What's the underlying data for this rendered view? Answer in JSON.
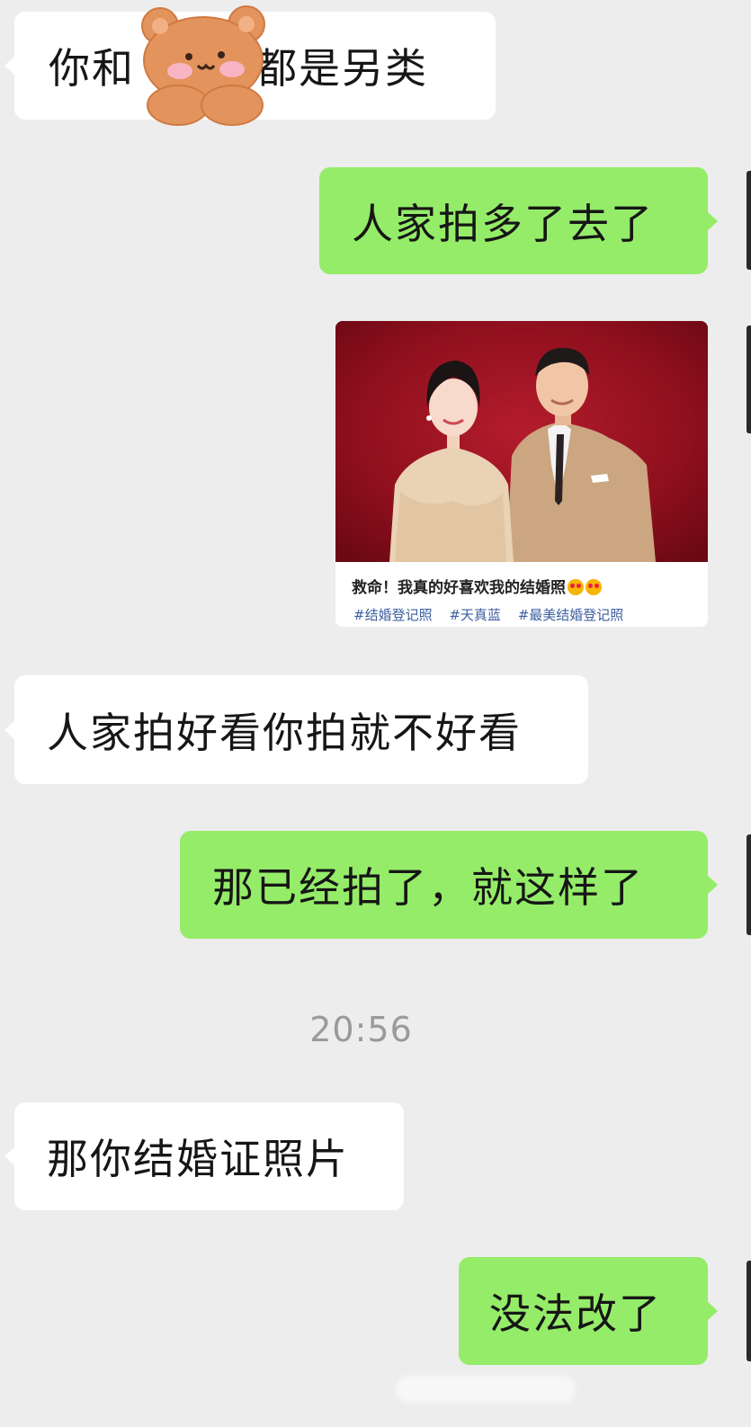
{
  "messages": [
    {
      "side": "in",
      "parts": [
        "你和",
        "都是另类"
      ]
    },
    {
      "side": "out",
      "text": "人家拍多了去了"
    },
    {
      "side": "out",
      "kind": "image-card",
      "caption": "救命！我真的好喜欢我的结婚照",
      "tags": [
        "#结婚登记照",
        "#天真蓝",
        "#最美结婚登记照"
      ]
    },
    {
      "side": "in",
      "text": "人家拍好看你拍就不好看"
    },
    {
      "side": "out",
      "text": "那已经拍了，就这样了"
    },
    {
      "side": "in",
      "text": "那你结婚证照片"
    },
    {
      "side": "out",
      "text": "没法改了"
    }
  ],
  "timestamp": "20:56",
  "colors": {
    "background": "#ededed",
    "incoming_bubble": "#ffffff",
    "outgoing_bubble": "#95ec69",
    "photo_backdrop": "#a01424",
    "tag_link": "#3d5f9e"
  },
  "icons": [
    "teddy-bear-sticker",
    "heart-eyes-emoji"
  ]
}
